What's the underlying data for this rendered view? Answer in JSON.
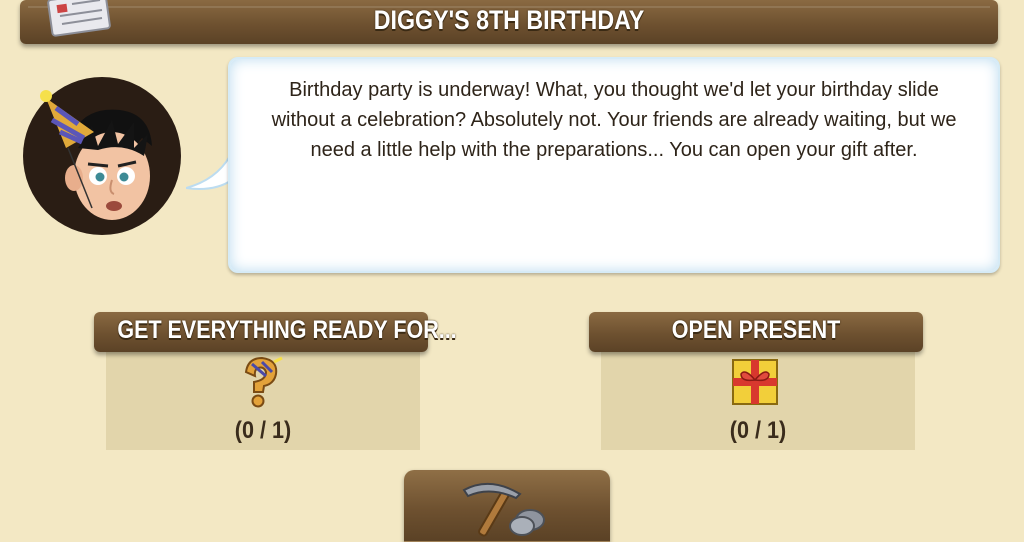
{
  "header": {
    "title": "DIGGY'S 8TH BIRTHDAY",
    "quest_icon": "quest-scroll-icon"
  },
  "dialog": {
    "speaker_avatar": "diggy-party-hat-avatar",
    "message": "Birthday party is underway! What, you thought we'd let your birthday slide without a celebration? Absolutely not. Your friends are already waiting, but we need a little help with the preparations... You can open your gift after."
  },
  "tasks": [
    {
      "label": "GET EVERYTHING READY FOR...",
      "icon": "question-mark-icon",
      "progress": "(0 / 1)",
      "done": 0,
      "total": 1
    },
    {
      "label": "OPEN PRESENT",
      "icon": "gift-box-icon",
      "progress": "(0 / 1)",
      "done": 0,
      "total": 1
    }
  ],
  "actions": {
    "dig_button_icon": "pickaxe-stone-icon"
  },
  "colors": {
    "background": "#f3e8c4",
    "plank": "#6e5130",
    "task_panel": "#e2d5ab",
    "bubble_glow": "#bcdcf0"
  }
}
